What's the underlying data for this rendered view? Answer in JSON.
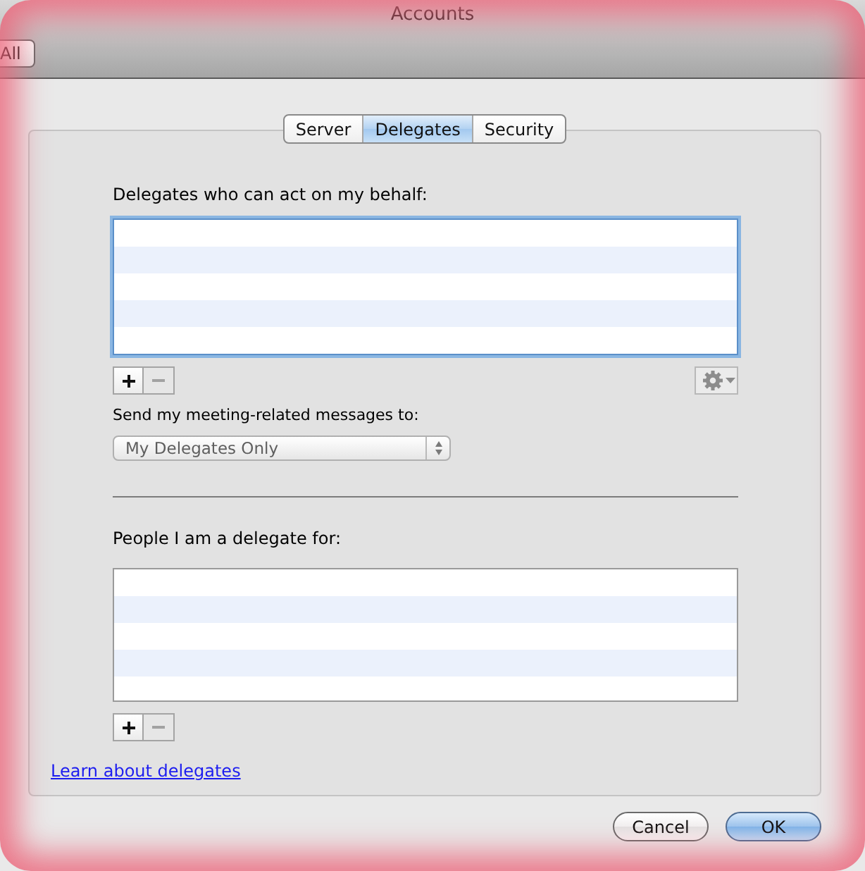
{
  "window": {
    "title": "Accounts"
  },
  "toolbar": {
    "buttons": [
      {
        "label": "All"
      }
    ]
  },
  "tabs": [
    {
      "label": "Server",
      "selected": false
    },
    {
      "label": "Delegates",
      "selected": true
    },
    {
      "label": "Security",
      "selected": false
    }
  ],
  "delegates": {
    "label": "Delegates who can act on my behalf:",
    "list": {
      "focused": true
    },
    "buttons": [
      {
        "kind": "add",
        "disabled": false
      },
      {
        "kind": "remove",
        "disabled": true
      }
    ]
  },
  "meeting_messages": {
    "label": "Send my meeting-related messages to:",
    "popup": {
      "value": "My Delegates Only",
      "disabled": true
    }
  },
  "delegate_for": {
    "label": "People I am a delegate for:",
    "list": {
      "focused": false
    },
    "buttons": [
      {
        "kind": "add",
        "disabled": false
      },
      {
        "kind": "remove",
        "disabled": true
      }
    ]
  },
  "link": "Learn about delegates",
  "footer_buttons": [
    {
      "label": "Cancel",
      "default": false
    },
    {
      "label": "OK",
      "default": true
    }
  ]
}
